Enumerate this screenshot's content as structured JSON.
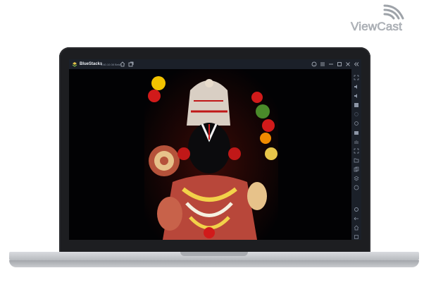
{
  "watermark": {
    "text": "ViewCast",
    "icon": "signal-waves-icon"
  },
  "emulator": {
    "app_name": "BlueStacks",
    "version": "4.60.10.08 Beta",
    "titlebar_icons": [
      "home-icon",
      "multi-instance-icon",
      "help-icon",
      "menu-icon",
      "minimize-icon",
      "maximize-icon",
      "close-icon",
      "collapse-sidebar-icon"
    ],
    "sidebar_icons": [
      "fullscreen-icon",
      "volume-up-icon",
      "volume-down-icon",
      "keymapping-icon",
      "eye-icon",
      "rotate-icon",
      "camera-icon",
      "record-icon",
      "screenshot-icon",
      "folder-icon",
      "copy-icon",
      "layers-icon",
      "location-icon",
      "settings-icon",
      "back-icon",
      "home-icon",
      "recents-icon"
    ]
  },
  "content": {
    "image_subject": "deity-wallpaper-art"
  },
  "colors": {
    "titlebar": "#1b2029",
    "screen_bg": "#020204",
    "laptop_body": "#1d1e21",
    "accent": "#e8c64a"
  }
}
